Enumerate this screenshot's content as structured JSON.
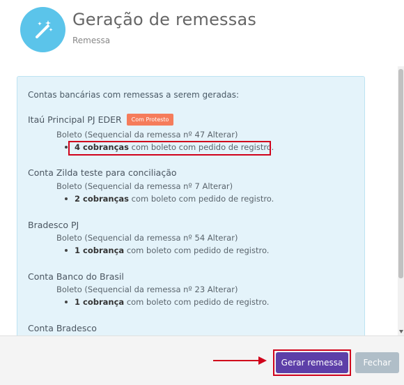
{
  "header": {
    "title": "Geração de remessas",
    "subtitle": "Remessa",
    "icon": "magic-wand-icon"
  },
  "panel": {
    "intro": "Contas bancárias com remessas a serem geradas:",
    "accounts": [
      {
        "name": "Itaú Principal PJ EDER",
        "badge": "Com Protesto",
        "boleto": "Boleto (Sequencial da remessa nº 47 Alterar)",
        "count": "4 cobranças",
        "detail": "com boleto com pedido de registro."
      },
      {
        "name": "Conta Zilda teste para conciliação",
        "boleto": "Boleto (Sequencial da remessa nº 7 Alterar)",
        "count": "2 cobranças",
        "detail": "com boleto com pedido de registro."
      },
      {
        "name": "Bradesco PJ",
        "boleto": "Boleto (Sequencial da remessa nº 54 Alterar)",
        "count": "1 cobrança",
        "detail": "com boleto com pedido de registro."
      },
      {
        "name": "Conta Banco do Brasil",
        "boleto": "Boleto (Sequencial da remessa nº 23 Alterar)",
        "count": "1 cobrança",
        "detail": "com boleto com pedido de registro."
      },
      {
        "name": "Conta Bradesco"
      }
    ]
  },
  "footer": {
    "gerar_label": "Gerar remessa",
    "fechar_label": "Fechar"
  },
  "colors": {
    "icon_bg": "#5bc4ea",
    "panel_bg": "#e4f3fa",
    "badge": "#f57c5b",
    "primary": "#5d3fa8",
    "secondary": "#b0bec8",
    "annotation": "#d0021b"
  }
}
